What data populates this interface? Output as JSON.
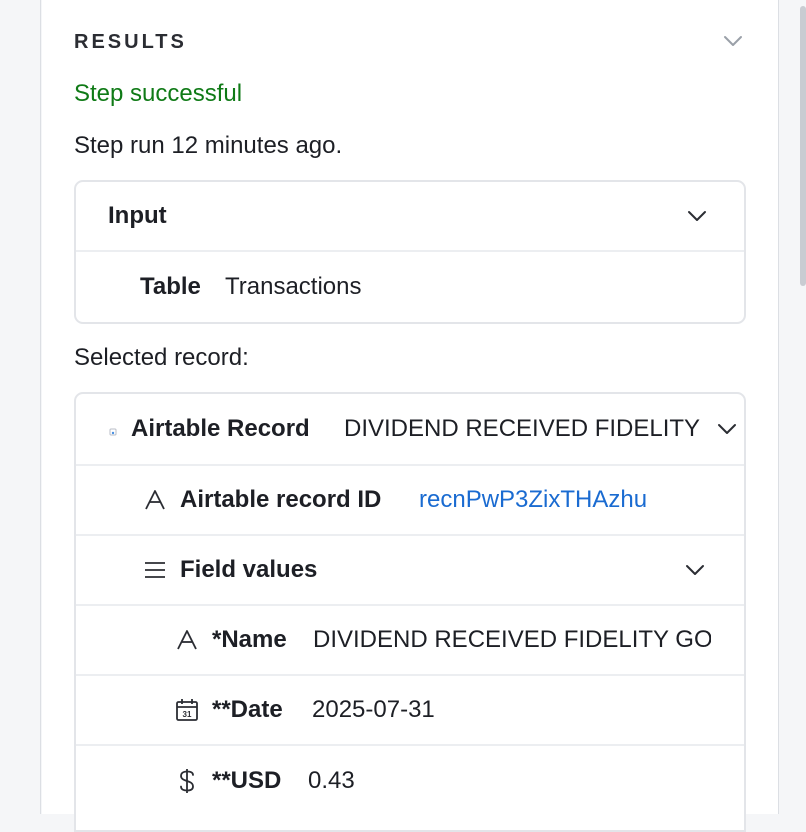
{
  "results": {
    "title": "RESULTS",
    "status": "Step successful",
    "run_info": "Step run 12 minutes ago."
  },
  "input": {
    "heading": "Input",
    "rows": [
      {
        "label": "Table",
        "value": "Transactions"
      }
    ]
  },
  "selected_label": "Selected record:",
  "record": {
    "label": "Airtable Record",
    "value": "DIVIDEND RECEIVED FIDELITY",
    "id_label": "Airtable record ID",
    "id_value": "recnPwP3ZixTHAzhu",
    "field_values_label": "Field values",
    "fields": [
      {
        "icon": "text-icon",
        "label": "*Name",
        "value": "DIVIDEND RECEIVED FIDELITY GOVERNMENT"
      },
      {
        "icon": "calendar-icon",
        "calendar_day": "31",
        "label": "**Date",
        "value": "2025-07-31"
      },
      {
        "icon": "dollar-icon",
        "label": "**USD",
        "value": "0.43"
      }
    ]
  },
  "colors": {
    "success": "#0f7a16",
    "link": "#1a6bd1"
  }
}
